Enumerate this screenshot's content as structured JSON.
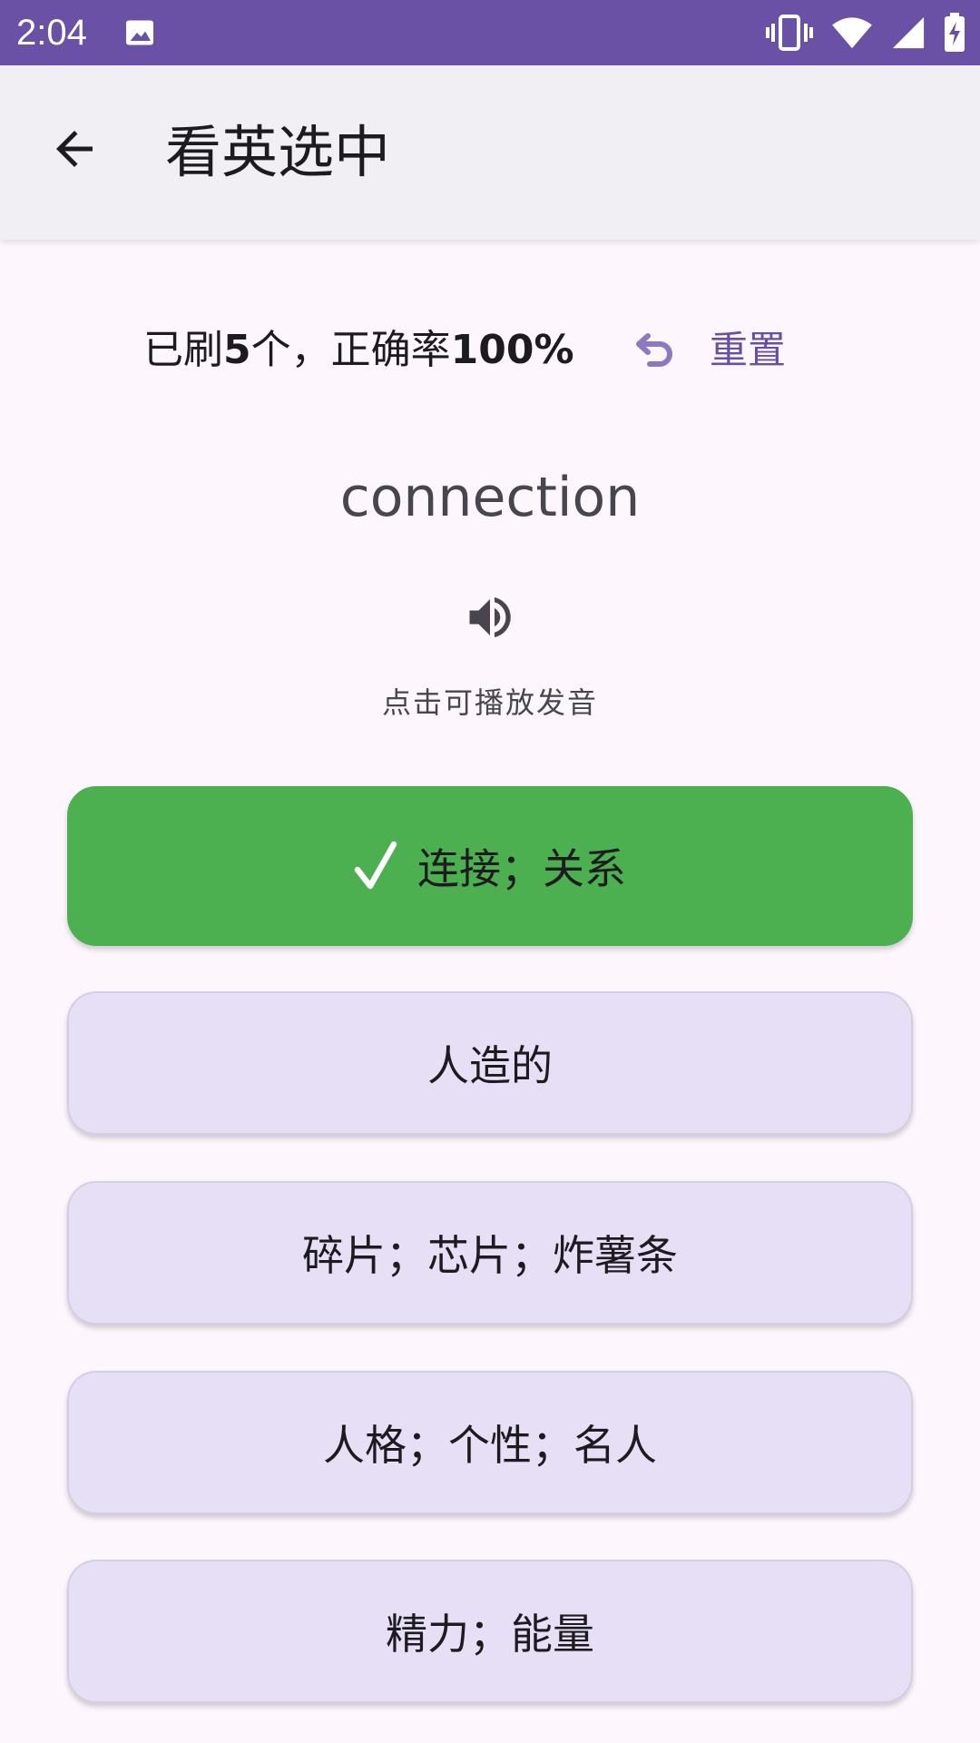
{
  "status_bar": {
    "time": "2:04",
    "color": "#6a51a6"
  },
  "app_bar": {
    "title": "看英选中",
    "back_icon": "arrow-left-icon"
  },
  "stats": {
    "prefix": "已刷",
    "count": "5",
    "middle": "个，正确率",
    "accuracy": "100%",
    "reset_label": "重置",
    "reset_icon": "undo-icon"
  },
  "quiz": {
    "word": "connection",
    "speaker_icon": "volume-icon",
    "hint": "点击可播放发音",
    "options": [
      {
        "label": "连接；关系",
        "state": "correct",
        "color": "#4caf50"
      },
      {
        "label": "人造的",
        "state": "default"
      },
      {
        "label": "碎片；芯片；炸薯条",
        "state": "default"
      },
      {
        "label": "人格；个性；名人",
        "state": "default"
      },
      {
        "label": "精力；能量",
        "state": "default"
      }
    ]
  }
}
